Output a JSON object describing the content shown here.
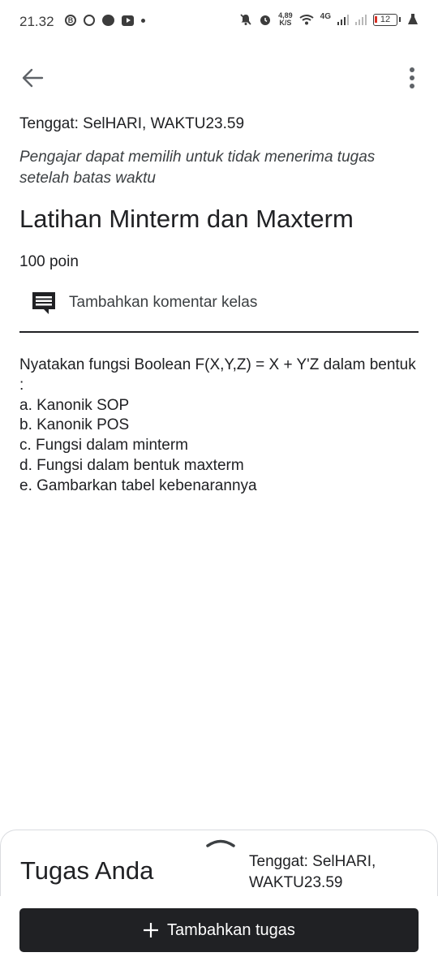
{
  "status_bar": {
    "time": "21.32",
    "left_icons": [
      "b-circle-icon",
      "whatsapp-icon",
      "chat-bubble-icon",
      "youtube-icon",
      "dot-icon"
    ],
    "speed_value": "4,89",
    "speed_unit": "K/S",
    "network": "4G",
    "battery": "12",
    "right_icons": [
      "bell-off-icon",
      "alarm-icon",
      "wifi-icon",
      "signal-icon",
      "signal-icon",
      "battery-icon",
      "flask-icon"
    ]
  },
  "app_bar": {
    "back_icon": "arrow-left-icon",
    "menu_icon": "more-vert-icon"
  },
  "assignment": {
    "due": "Tenggat: SelHARI, WAKTU23.59",
    "late_note": "Pengajar dapat memilih untuk tidak menerima tugas setelah batas waktu",
    "title": "Latihan Minterm dan Maxterm",
    "points": "100 poin",
    "comment_label": "Tambahkan komentar kelas",
    "description": [
      "Nyatakan fungsi Boolean F(X,Y,Z) = X + Y'Z dalam bentuk :",
      "a. Kanonik SOP",
      "b. Kanonik POS",
      "c. Fungsi dalam minterm",
      "d. Fungsi dalam bentuk maxterm",
      "e. Gambarkan tabel kebenarannya"
    ]
  },
  "sheet": {
    "title": "Tugas Anda",
    "due": "Tenggat: SelHARI, WAKTU23.59",
    "add_button": "Tambahkan tugas",
    "add_icon": "plus-icon"
  },
  "colors": {
    "text": "#202124",
    "secondary_text": "#3c4043",
    "button_bg": "#202124",
    "battery_low": "#d93025"
  }
}
